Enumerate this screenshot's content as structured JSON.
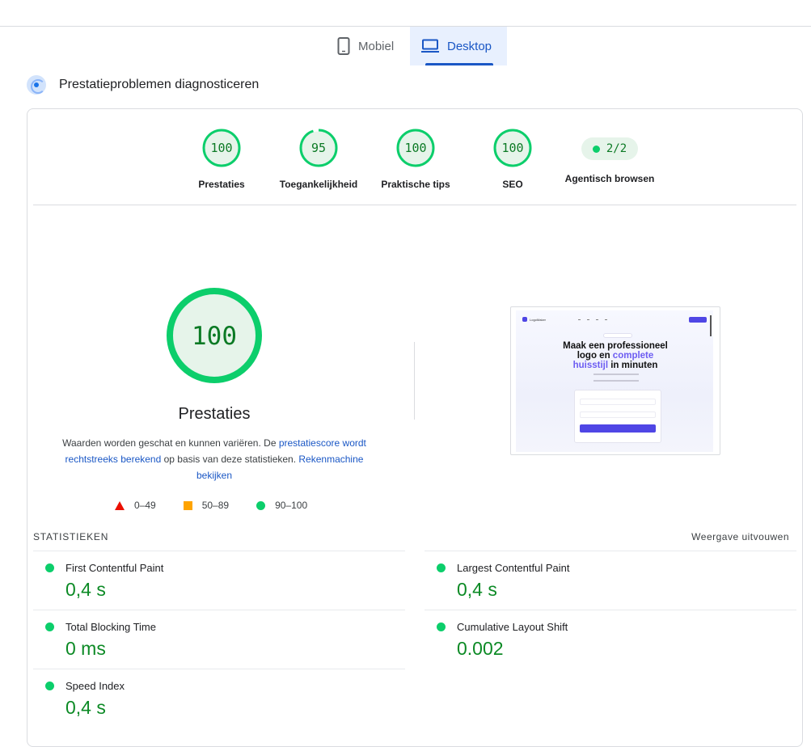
{
  "tabs": [
    {
      "label": "Mobiel",
      "icon": "phone-icon",
      "active": false
    },
    {
      "label": "Desktop",
      "icon": "laptop-icon",
      "active": true
    }
  ],
  "diagnose": {
    "title": "Prestatieproblemen diagnosticeren"
  },
  "categories": [
    {
      "label": "Prestaties",
      "score": "100",
      "value": 100
    },
    {
      "label": "Toegankelijkheid",
      "score": "95",
      "value": 95
    },
    {
      "label": "Praktische tips",
      "score": "100",
      "value": 100
    },
    {
      "label": "SEO",
      "score": "100",
      "value": 100
    },
    {
      "label": "Agentisch browsen",
      "score": "2/2"
    }
  ],
  "performance": {
    "score": "100",
    "title": "Prestaties",
    "desc_part1": "Waarden worden geschat en kunnen variëren. De ",
    "desc_link1": "prestatiescore wordt rechtstreeks berekend",
    "desc_part2": " op basis van deze statistieken. ",
    "desc_link2": "Rekenmachine bekijken"
  },
  "legend": [
    {
      "label": "0–49",
      "color": "#eb0f00"
    },
    {
      "label": "50–89",
      "color": "#ffa400"
    },
    {
      "label": "90–100",
      "color": "#0cce6b"
    }
  ],
  "thumbnail": {
    "brand": "LogoMaker",
    "headline_1": "Maak een professioneel",
    "headline_2": "logo en ",
    "headline_accent_1": "complete",
    "headline_accent_2": "huisstijl",
    "headline_3": " in minuten"
  },
  "statistics": {
    "heading": "STATISTIEKEN",
    "expand": "Weergave uitvouwen",
    "metrics": [
      {
        "name": "First Contentful Paint",
        "value": "0,4 s"
      },
      {
        "name": "Largest Contentful Paint",
        "value": "0,4 s"
      },
      {
        "name": "Total Blocking Time",
        "value": "0 ms"
      },
      {
        "name": "Cumulative Layout Shift",
        "value": "0.002"
      },
      {
        "name": "Speed Index",
        "value": "0,4 s"
      }
    ]
  },
  "colors": {
    "pass": "#0cce6b",
    "pass_text": "#0c7a25",
    "accent": "#1a57c5"
  }
}
